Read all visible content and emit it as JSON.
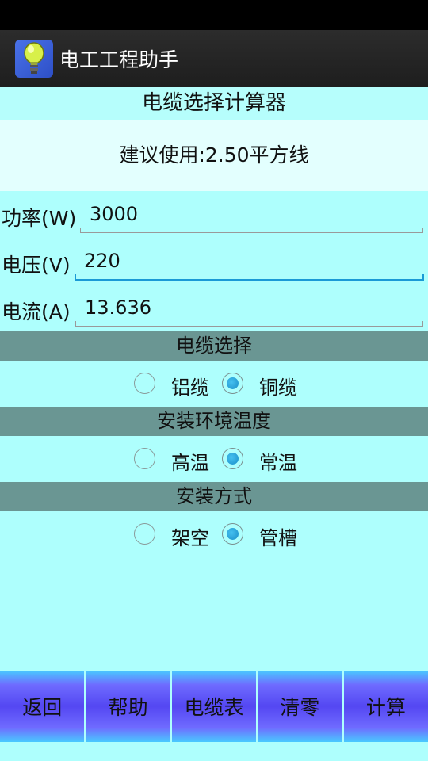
{
  "app": {
    "title": "电工工程助手"
  },
  "calculator": {
    "title": "电缆选择计算器",
    "result": "建议使用:2.50平方线"
  },
  "fields": {
    "power": {
      "label": "功率(W)",
      "value": "3000"
    },
    "voltage": {
      "label": "电压(V)",
      "value": "220"
    },
    "current": {
      "label": "电流(A)",
      "value": "13.636"
    }
  },
  "sections": {
    "cable": {
      "header": "电缆选择",
      "options": [
        "铝缆",
        "铜缆"
      ],
      "selected": "铜缆"
    },
    "temperature": {
      "header": "安装环境温度",
      "options": [
        "高温",
        "常温"
      ],
      "selected": "常温"
    },
    "method": {
      "header": "安装方式",
      "options": [
        "架空",
        "管槽"
      ],
      "selected": "管槽"
    }
  },
  "buttons": {
    "back": "返回",
    "help": "帮助",
    "cable_table": "电缆表",
    "clear": "清零",
    "calculate": "计算"
  },
  "colors": {
    "background": "#aefffd",
    "section_header": "#6a9693",
    "accent": "#1a9ad6"
  }
}
